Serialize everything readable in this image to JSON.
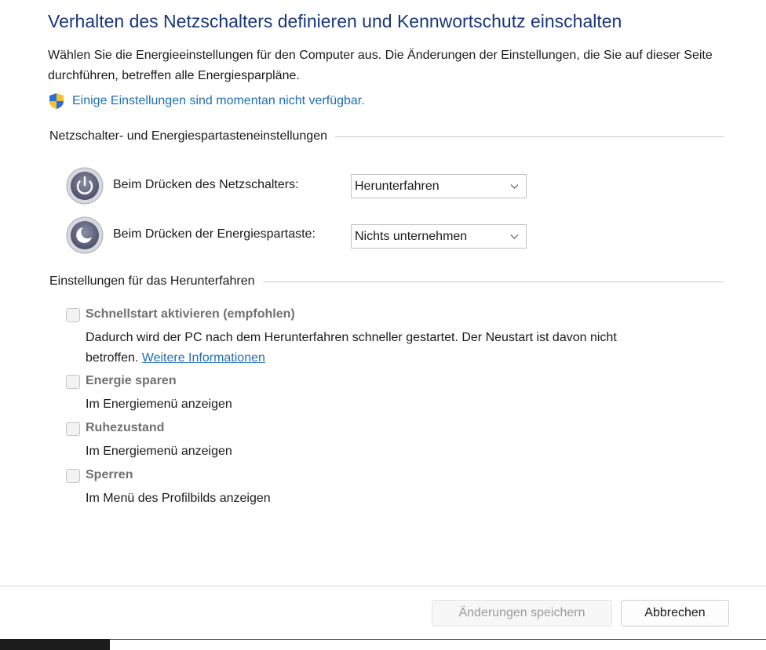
{
  "page": {
    "title": "Verhalten des Netzschalters definieren und Kennwortschutz einschalten",
    "description": "Wählen Sie die Energieeinstellungen für den Computer aus. Die Änderungen der Einstellungen, die Sie auf dieser Seite durchführen, betreffen alle Energiesparpläne.",
    "notice_link": "Einige Einstellungen sind momentan nicht verfügbar."
  },
  "power_section": {
    "heading": "Netzschalter- und Energiespartasteneinstellungen",
    "rows": [
      {
        "label": "Beim Drücken des Netzschalters:",
        "value": "Herunterfahren",
        "icon": "power-icon"
      },
      {
        "label": "Beim Drücken der Energiespartaste:",
        "value": "Nichts unternehmen",
        "icon": "sleep-icon"
      }
    ]
  },
  "shutdown_section": {
    "heading": "Einstellungen für das Herunterfahren",
    "options": [
      {
        "title": "Schnellstart aktivieren (empfohlen)",
        "desc_line1": "Dadurch wird der PC nach dem Herunterfahren schneller gestartet. Der Neustart ist davon nicht",
        "desc_line2": "betroffen.",
        "link": "Weitere Informationen",
        "checked": false
      },
      {
        "title": "Energie sparen",
        "desc": "Im Energiemenü anzeigen",
        "checked": false
      },
      {
        "title": "Ruhezustand",
        "desc": "Im Energiemenü anzeigen",
        "checked": false
      },
      {
        "title": "Sperren",
        "desc": "Im Menü des Profilbilds anzeigen",
        "checked": false
      }
    ]
  },
  "buttons": {
    "save": "Änderungen speichern",
    "cancel": "Abbrechen"
  },
  "colors": {
    "title": "#19367a",
    "link": "#1f6fb3",
    "disabled_text": "#707070"
  }
}
